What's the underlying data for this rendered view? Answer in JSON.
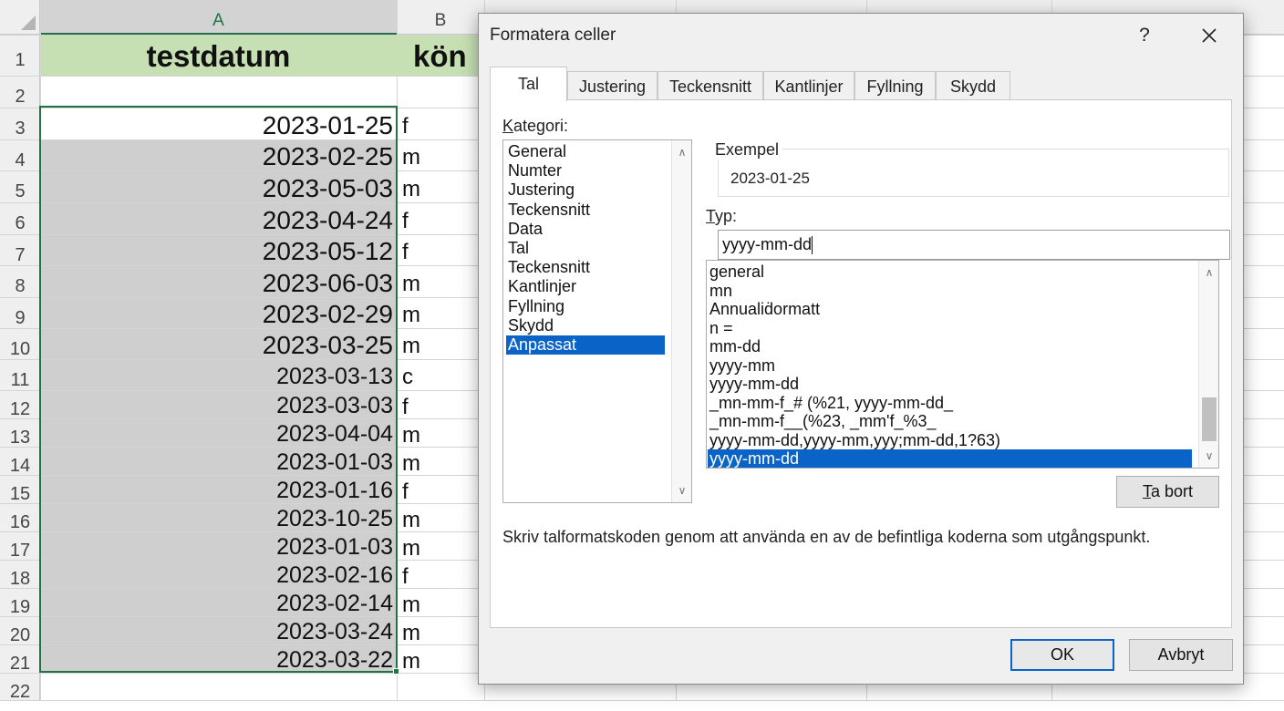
{
  "sheet": {
    "columns": [
      "A",
      "B"
    ],
    "header": {
      "a": "testdatum",
      "b": "kön"
    },
    "row_numbers": [
      "1",
      "2",
      "3",
      "4",
      "5",
      "6",
      "7",
      "8",
      "9",
      "10",
      "11",
      "12",
      "13",
      "14",
      "15",
      "16",
      "17",
      "18",
      "19",
      "20",
      "21",
      "22"
    ],
    "rows": [
      {
        "date": "2023-01-25",
        "gender": "f"
      },
      {
        "date": "2023-02-25",
        "gender": "m"
      },
      {
        "date": "2023-05-03",
        "gender": "m"
      },
      {
        "date": "2023-04-24",
        "gender": "f"
      },
      {
        "date": "2023-05-12",
        "gender": "f"
      },
      {
        "date": "2023-06-03",
        "gender": "m"
      },
      {
        "date": "2023-02-29",
        "gender": "m"
      },
      {
        "date": "2023-03-25",
        "gender": "m"
      },
      {
        "date": "2023-03-13",
        "gender": "c"
      },
      {
        "date": "2023-03-03",
        "gender": "f"
      },
      {
        "date": "2023-04-04",
        "gender": "m"
      },
      {
        "date": "2023-01-03",
        "gender": "m"
      },
      {
        "date": "2023-01-16",
        "gender": "f"
      },
      {
        "date": "2023-10-25",
        "gender": "m"
      },
      {
        "date": "2023-01-03",
        "gender": "m"
      },
      {
        "date": "2023-02-16",
        "gender": "f"
      },
      {
        "date": "2023-02-14",
        "gender": "m"
      },
      {
        "date": "2023-03-24",
        "gender": "m"
      },
      {
        "date": "2023-03-22",
        "gender": "m"
      }
    ]
  },
  "dialog": {
    "title": "Formatera celler",
    "help": "?",
    "tabs": [
      "Tal",
      "Justering",
      "Teckensnitt",
      "Kantlinjer",
      "Fyllning",
      "Skydd"
    ],
    "active_tab": "Tal",
    "category_label_first": "K",
    "category_label_rest": "ategori:",
    "categories": [
      "General",
      "Numter",
      "Justering",
      "Teckensnitt",
      "Data",
      "Tal",
      "Teckensnitt",
      "Kantlinjer",
      "Fyllning",
      "Skydd",
      "Anpassat"
    ],
    "selected_category": "Anpassat",
    "example_label": "Exempel",
    "example_value": "2023-01-25",
    "type_label_first": "T",
    "type_label_rest": "yp:",
    "type_value": "yyyy-mm-dd",
    "formats": [
      "general",
      "mn",
      "Annualiḋormatt",
      "n =",
      "mm-dd",
      "yyyy-mm",
      "yyyy-mm-dd",
      "_mn-mm-f_# (%21, yyyy-mm-dd_",
      "_mn-mm-f__(%23, _mm'f_%3_",
      "yyyy-mm-dd,yyyy-mm,yyy;mm-dd,1?63)",
      "yyyy-mm-dd"
    ],
    "selected_format_index": 10,
    "delete_label_first": "T",
    "delete_label_rest": "a bort",
    "hint": "Skriv talformatskoden genom att använda en av de befintliga koderna som utgångspunkt.",
    "ok": "OK",
    "cancel": "Avbryt"
  },
  "colors": {
    "header_fill": "#c6e0b4",
    "selection_green": "#217346",
    "selected_row_blue": "#0a64c8"
  }
}
